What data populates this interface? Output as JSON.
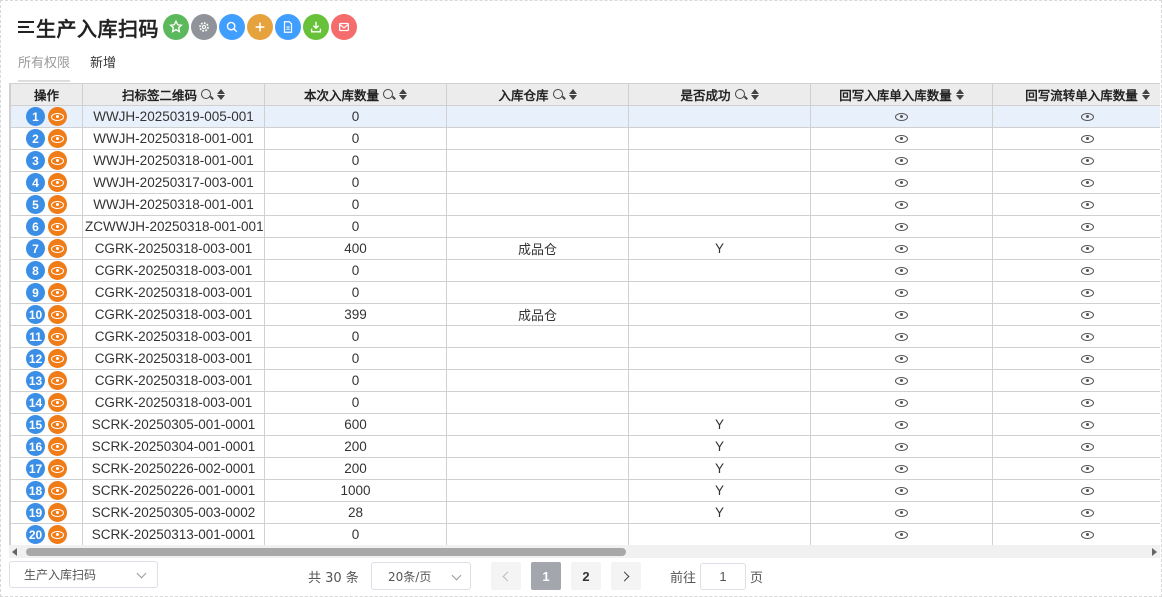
{
  "header": {
    "title": "生产入库扫码",
    "toolbar": [
      {
        "name": "favorite-icon",
        "color": "#5cb85c"
      },
      {
        "name": "settings-icon",
        "color": "#909399"
      },
      {
        "name": "search-icon",
        "color": "#409eff"
      },
      {
        "name": "add-icon",
        "color": "#e6a23c"
      },
      {
        "name": "document-icon",
        "color": "#409eff"
      },
      {
        "name": "export-icon",
        "color": "#67c23a"
      },
      {
        "name": "delete-icon",
        "color": "#f56c6c"
      }
    ]
  },
  "tabs": [
    {
      "label": "所有权限",
      "active": true
    },
    {
      "label": "新增",
      "active": false
    }
  ],
  "table": {
    "columns": [
      {
        "label": "操作"
      },
      {
        "label": "扫标签二维码"
      },
      {
        "label": "本次入库数量"
      },
      {
        "label": "入库仓库"
      },
      {
        "label": "是否成功"
      },
      {
        "label": "回写入库单入库数量"
      },
      {
        "label": "回写流转单入库数量"
      }
    ],
    "rows": [
      {
        "num": "1",
        "code": "WWJH-20250319-005-001",
        "qty": "0",
        "warehouse": "",
        "success": "",
        "selected": true
      },
      {
        "num": "2",
        "code": "WWJH-20250318-001-001",
        "qty": "0",
        "warehouse": "",
        "success": ""
      },
      {
        "num": "3",
        "code": "WWJH-20250318-001-001",
        "qty": "0",
        "warehouse": "",
        "success": ""
      },
      {
        "num": "4",
        "code": "WWJH-20250317-003-001",
        "qty": "0",
        "warehouse": "",
        "success": ""
      },
      {
        "num": "5",
        "code": "WWJH-20250318-001-001",
        "qty": "0",
        "warehouse": "",
        "success": ""
      },
      {
        "num": "6",
        "code": "ZCWWJH-20250318-001-001",
        "qty": "0",
        "warehouse": "",
        "success": ""
      },
      {
        "num": "7",
        "code": "CGRK-20250318-003-001",
        "qty": "400",
        "warehouse": "成品仓",
        "success": "Y"
      },
      {
        "num": "8",
        "code": "CGRK-20250318-003-001",
        "qty": "0",
        "warehouse": "",
        "success": ""
      },
      {
        "num": "9",
        "code": "CGRK-20250318-003-001",
        "qty": "0",
        "warehouse": "",
        "success": ""
      },
      {
        "num": "10",
        "code": "CGRK-20250318-003-001",
        "qty": "399",
        "warehouse": "成品仓",
        "success": ""
      },
      {
        "num": "11",
        "code": "CGRK-20250318-003-001",
        "qty": "0",
        "warehouse": "",
        "success": ""
      },
      {
        "num": "12",
        "code": "CGRK-20250318-003-001",
        "qty": "0",
        "warehouse": "",
        "success": ""
      },
      {
        "num": "13",
        "code": "CGRK-20250318-003-001",
        "qty": "0",
        "warehouse": "",
        "success": ""
      },
      {
        "num": "14",
        "code": "CGRK-20250318-003-001",
        "qty": "0",
        "warehouse": "",
        "success": ""
      },
      {
        "num": "15",
        "code": "SCRK-20250305-001-0001",
        "qty": "600",
        "warehouse": "",
        "success": "Y"
      },
      {
        "num": "16",
        "code": "SCRK-20250304-001-0001",
        "qty": "200",
        "warehouse": "",
        "success": "Y"
      },
      {
        "num": "17",
        "code": "SCRK-20250226-002-0001",
        "qty": "200",
        "warehouse": "",
        "success": "Y"
      },
      {
        "num": "18",
        "code": "SCRK-20250226-001-0001",
        "qty": "1000",
        "warehouse": "",
        "success": "Y"
      },
      {
        "num": "19",
        "code": "SCRK-20250305-003-0002",
        "qty": "28",
        "warehouse": "",
        "success": "Y"
      },
      {
        "num": "20",
        "code": "SCRK-20250313-001-0001",
        "qty": "0",
        "warehouse": "",
        "success": ""
      }
    ]
  },
  "footer": {
    "view_select": "生产入库扫码",
    "total": "共 30 条",
    "page_size": "20条/页",
    "pages": [
      "1",
      "2"
    ],
    "current_page": "1",
    "goto_label": "前往",
    "goto_value": "1",
    "goto_suffix": "页"
  }
}
